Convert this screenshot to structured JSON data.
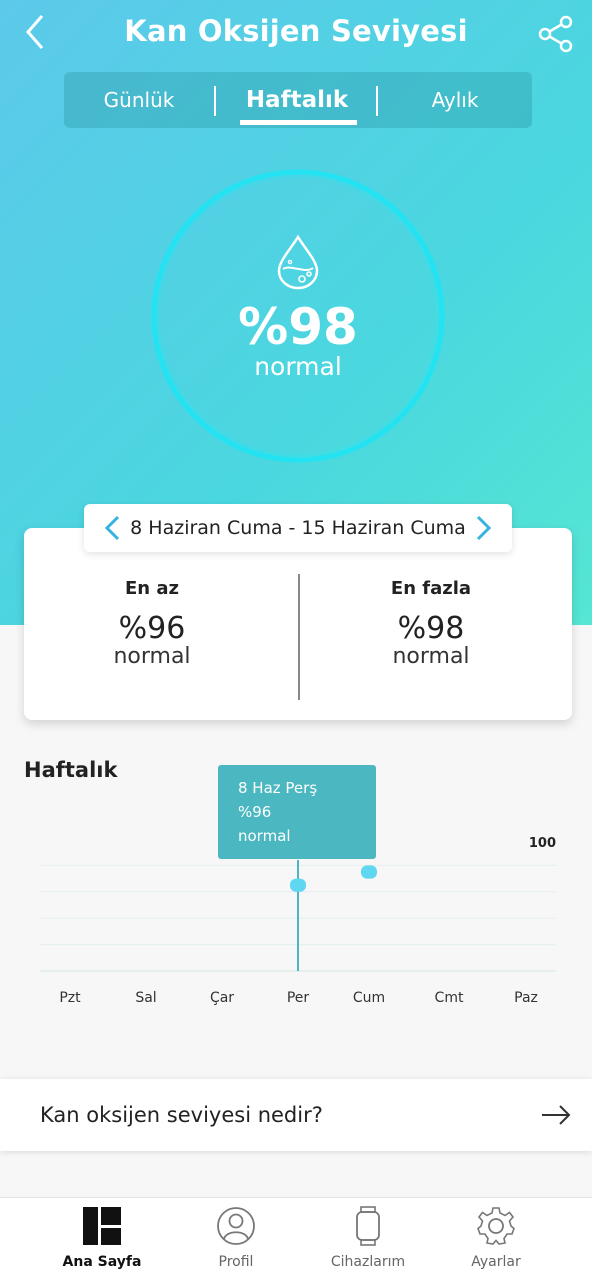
{
  "header": {
    "title": "Kan Oksijen Seviyesi",
    "back_icon": "chevron-left-icon",
    "share_icon": "share-icon"
  },
  "tabs": [
    {
      "label": "Günlük",
      "active": false
    },
    {
      "label": "Haftalık",
      "active": true
    },
    {
      "label": "Aylık",
      "active": false
    }
  ],
  "gauge": {
    "value": "%98",
    "status": "normal",
    "icon": "water-drop-icon"
  },
  "date_range": {
    "label": "8 Haziran Cuma - 15 Haziran Cuma",
    "prev_icon": "chevron-left-icon",
    "next_icon": "chevron-right-icon"
  },
  "summary": {
    "min": {
      "label": "En az",
      "value": "%96",
      "status": "normal"
    },
    "max": {
      "label": "En fazla",
      "value": "%98",
      "status": "normal"
    }
  },
  "weekly": {
    "title": "Haftalık",
    "tooltip": {
      "line1": "8 Haz Perş",
      "line2": "%96",
      "line3": "normal"
    }
  },
  "chart_data": {
    "type": "bar",
    "categories": [
      "Pzt",
      "Sal",
      "Çar",
      "Per",
      "Cum",
      "Cmt",
      "Paz"
    ],
    "series": [
      {
        "values": [
          null,
          null,
          null,
          [
            96,
            97
          ],
          [
            97,
            98
          ],
          null,
          null
        ]
      }
    ],
    "y_tick_labels": [
      "100"
    ],
    "ylim": [
      90,
      100
    ],
    "accent": "#5fd7f1",
    "selected_category": "Per"
  },
  "info": {
    "label": "Kan oksijen seviyesi nedir?",
    "arrow_icon": "arrow-right-icon"
  },
  "nav": [
    {
      "label": "Ana Sayfa",
      "icon": "dashboard-icon",
      "active": true
    },
    {
      "label": "Profil",
      "icon": "user-icon",
      "active": false
    },
    {
      "label": "Cihazlarım",
      "icon": "watch-icon",
      "active": false
    },
    {
      "label": "Ayarlar",
      "icon": "gear-icon",
      "active": false
    }
  ],
  "colors": {
    "accent": "#4bb7c0",
    "hero_start": "#5cc9ea",
    "hero_end": "#56e6d3",
    "ring": "#21e2f4"
  }
}
